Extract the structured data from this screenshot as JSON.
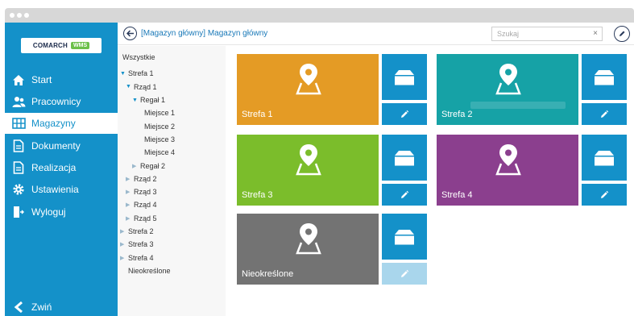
{
  "app": {
    "logo_brand": "COMARCH",
    "logo_badge": "WMS"
  },
  "nav": {
    "items": [
      {
        "label": "Start",
        "icon": "home-icon",
        "active": false
      },
      {
        "label": "Pracownicy",
        "icon": "users-icon",
        "active": false
      },
      {
        "label": "Magazyny",
        "icon": "warehouse-icon",
        "active": true
      },
      {
        "label": "Dokumenty",
        "icon": "document-icon",
        "active": false
      },
      {
        "label": "Realizacja",
        "icon": "document-icon",
        "active": false
      },
      {
        "label": "Ustawienia",
        "icon": "gear-icon",
        "active": false
      },
      {
        "label": "Wyloguj",
        "icon": "logout-icon",
        "active": false
      }
    ],
    "collapse_label": "Zwiń"
  },
  "header": {
    "breadcrumb": "[Magazyn główny] Magazyn główny",
    "search_placeholder": "Szukaj",
    "search_value": ""
  },
  "tree": {
    "root": "Wszystkie",
    "items": [
      {
        "label": "Strefa 1",
        "expanded": true
      },
      {
        "label": "Rząd 1",
        "expanded": true
      },
      {
        "label": "Regał 1",
        "expanded": true
      },
      {
        "label": "Miejsce 1"
      },
      {
        "label": "Miejsce 2"
      },
      {
        "label": "Miejsce 3"
      },
      {
        "label": "Miejsce 4"
      },
      {
        "label": "Regał 2",
        "expanded": false
      },
      {
        "label": "Rząd 2",
        "expanded": false
      },
      {
        "label": "Rząd 3",
        "expanded": false
      },
      {
        "label": "Rząd 4",
        "expanded": false
      },
      {
        "label": "Rząd 5",
        "expanded": false
      },
      {
        "label": "Strefa 2",
        "expanded": false
      },
      {
        "label": "Strefa 3",
        "expanded": false
      },
      {
        "label": "Strefa 4",
        "expanded": false
      },
      {
        "label": "Nieokreślone"
      }
    ]
  },
  "zones": [
    {
      "label": "Strefa 1",
      "color": "#e49b25"
    },
    {
      "label": "Strefa 2",
      "color": "#16a2a6"
    },
    {
      "label": "Strefa 3",
      "color": "#7bbd2b"
    },
    {
      "label": "Strefa 4",
      "color": "#8b3f8e"
    },
    {
      "label": "Nieokreślone",
      "color": "#737373"
    }
  ],
  "colors": {
    "accent": "#1491c9",
    "disabled_edit": "#a9d6ec"
  }
}
